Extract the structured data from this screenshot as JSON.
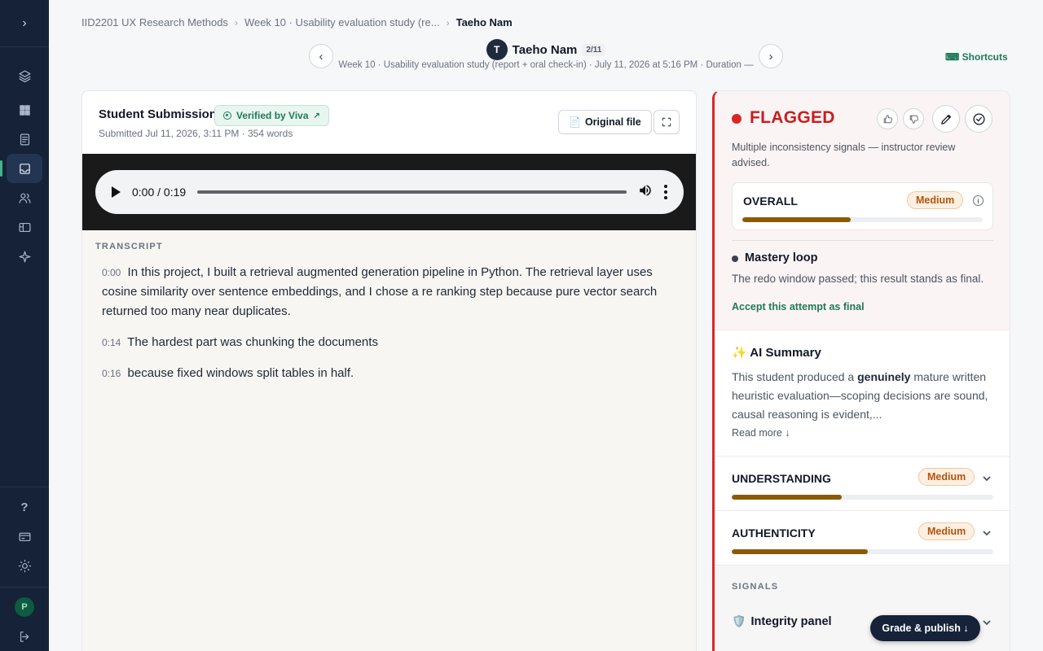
{
  "breadcrumb": {
    "course": "IID2201 UX Research Methods",
    "assignment": "Week 10 · Usability evaluation study (re...",
    "student": "Taeho Nam"
  },
  "student": {
    "initial": "T",
    "name": "Taeho Nam",
    "position": "2/11",
    "meta": "Week 10 · Usability evaluation study (report + oral check-in) · July 11, 2026 at 5:16 PM · Duration —",
    "prev_glyph": "‹",
    "next_glyph": "›"
  },
  "shortcuts_label": "⌨ Shortcuts",
  "submission": {
    "title": "Student Submission",
    "verified_label": "Verified by Viva",
    "verified_arrow": "↗",
    "meta": "Submitted Jul 11, 2026, 3:11 PM · 354 words",
    "original_file_label": "Original file",
    "file_glyph": "📄"
  },
  "audio": {
    "time": "0:00 / 0:19"
  },
  "transcript": {
    "label": "TRANSCRIPT",
    "segments": [
      {
        "ts": "0:00",
        "text": "In this project, I built a retrieval augmented generation pipeline in Python. The retrieval layer uses cosine similarity over sentence embeddings, and I chose a re ranking step because pure vector search returned too many near duplicates."
      },
      {
        "ts": "0:14",
        "text": "The hardest part was chunking the documents"
      },
      {
        "ts": "0:16",
        "text": "because fixed windows split tables in half."
      }
    ]
  },
  "review": {
    "status": "FLAGGED",
    "status_desc": "Multiple inconsistency signals — instructor review advised.",
    "overall": {
      "label": "OVERALL",
      "level": "Medium",
      "fill": 0.45
    },
    "info_glyph": "i",
    "mastery": {
      "title": "Mastery loop",
      "desc": "The redo window passed; this result stands as final.",
      "link": "Accept this attempt as final"
    },
    "ai_summary": {
      "title": "✨ AI Summary",
      "text_before": "This student produced a ",
      "text_bold": "genuinely",
      "text_after": " mature written heuristic evaluation—scoping decisions are sound, causal reasoning is evident,...",
      "read_more": "Read more ↓"
    },
    "understanding": {
      "label": "UNDERSTANDING",
      "level": "Medium",
      "fill": 0.42
    },
    "authenticity": {
      "label": "AUTHENTICITY",
      "level": "Medium",
      "fill": 0.52
    },
    "signals_label": "SIGNALS",
    "integrity_label": "Integrity panel",
    "integrity_glyph": "🛡️"
  },
  "grade_button": "Grade & publish ↓",
  "sidebar": {
    "expand_glyph": "›",
    "help_glyph": "?",
    "user_initial": "P"
  },
  "colors": {
    "sidebar_bg": "#152238",
    "accent_green": "#1f7a57",
    "flag_red": "#dc2626",
    "medium_bar": "#8b5a07"
  }
}
